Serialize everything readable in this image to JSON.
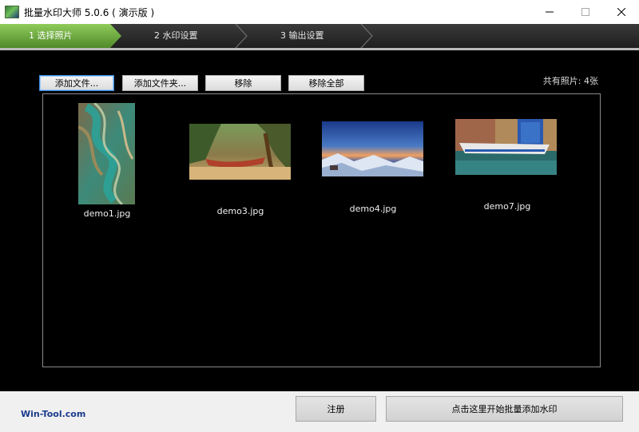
{
  "window": {
    "title": "批量水印大师 5.0.6 ( 演示版 )",
    "controls": {
      "minimize_icon": "minimize-icon",
      "maximize_icon": "maximize-icon",
      "close_icon": "close-icon"
    }
  },
  "steps": [
    {
      "label": "1 选择照片",
      "active": true
    },
    {
      "label": "2 水印设置",
      "active": false
    },
    {
      "label": "3 输出设置",
      "active": false
    }
  ],
  "toolbar": {
    "add_files": "添加文件...",
    "add_folder": "添加文件夹...",
    "remove": "移除",
    "remove_all": "移除全部",
    "photo_count": "共有照片: 4张"
  },
  "photos": [
    {
      "name": "demo1.jpg",
      "icon": "terraced-aerial-thumbnail"
    },
    {
      "name": "demo3.jpg",
      "icon": "beach-boat-thumbnail"
    },
    {
      "name": "demo4.jpg",
      "icon": "snowy-mountain-dusk-thumbnail"
    },
    {
      "name": "demo7.jpg",
      "icon": "harbor-boat-thumbnail"
    }
  ],
  "footer": {
    "brand": "Win-Tool.com",
    "register": "注册",
    "start": "点击这里开始批量添加水印"
  },
  "colors": {
    "active_step": "#6aa83a",
    "accent_focus": "#3a8ee6",
    "brand_text": "#1a3a8c"
  }
}
